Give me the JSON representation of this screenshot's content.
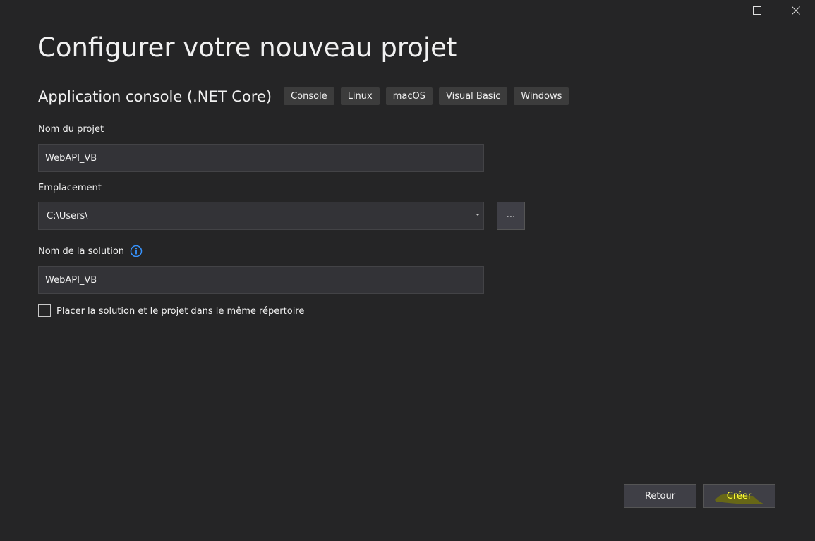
{
  "window": {
    "controls": {
      "maximize_icon": "maximize-icon",
      "close_icon": "close-icon"
    }
  },
  "page": {
    "title": "Configurer votre nouveau projet"
  },
  "template": {
    "name": "Application console (.NET Core)",
    "tags": [
      "Console",
      "Linux",
      "macOS",
      "Visual Basic",
      "Windows"
    ]
  },
  "form": {
    "project_name": {
      "label": "Nom du projet",
      "value": "WebAPI_VB"
    },
    "location": {
      "label": "Emplacement",
      "value": "C:\\Users\\",
      "browse_label": "..."
    },
    "solution_name": {
      "label": "Nom de la solution",
      "value": "WebAPI_VB",
      "info_icon": "info-icon"
    },
    "same_directory": {
      "label": "Placer la solution et le projet dans le même répertoire",
      "checked": false
    }
  },
  "footer": {
    "back_label": "Retour",
    "create_label": "Créer"
  },
  "colors": {
    "background": "#252526",
    "input_background": "#333337",
    "tag_background": "#3c3c3c",
    "button_background": "#3f3f46",
    "info_accent": "#3794ff",
    "highlight": "#ffff00"
  }
}
